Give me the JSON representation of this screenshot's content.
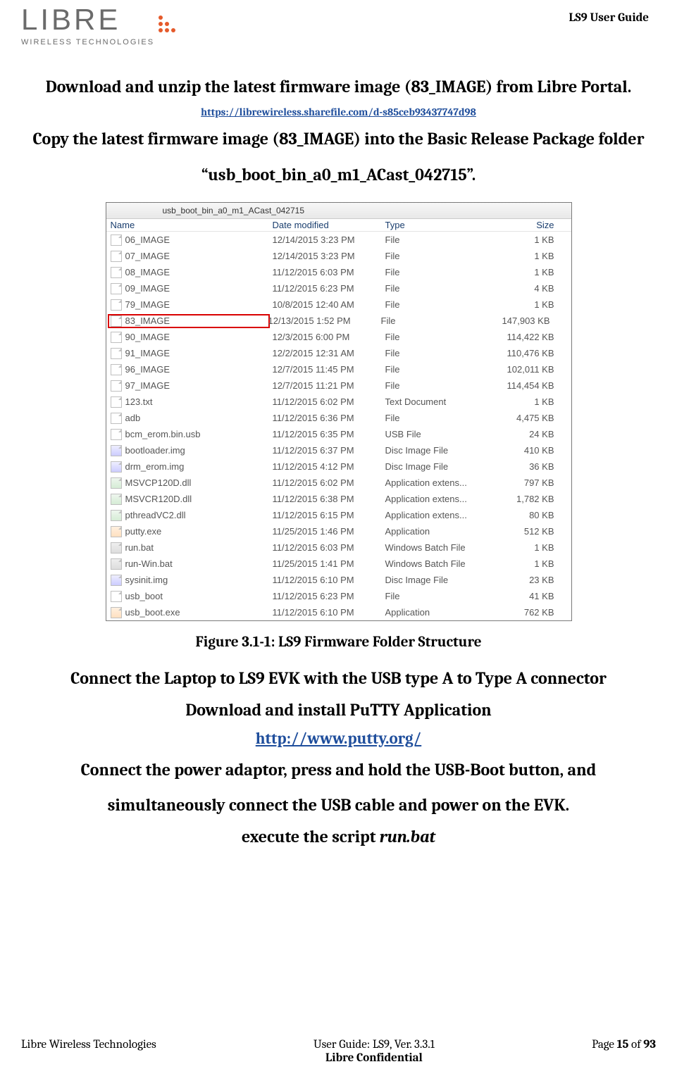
{
  "header": {
    "brand_main": "LIBRE",
    "brand_sub": "WIRELESS TECHNOLOGIES",
    "doc_title": "LS9 User Guide"
  },
  "body": {
    "instr1": "Download and unzip the latest firmware image (83_IMAGE) from Libre Portal.",
    "link1_text": "https://librewireless.sharefile.com/d-s85ceb93437747d98",
    "instr2": "Copy the latest firmware image (83_IMAGE) into the Basic Release Package folder “usb_boot_bin_a0_m1_ACast_042715”.",
    "figcap": "Figure 3.1-1: LS9 Firmware Folder Structure",
    "instr3": "Connect the Laptop to LS9 EVK with the USB type A to Type A connector",
    "instr4": "Download and install PuTTY Application",
    "link2_text": "http://www.putty.org/",
    "instr5": "Connect the power adaptor, press and hold the USB-Boot button, and simultaneously connect the USB cable and power on the EVK.",
    "instr6_prefix": "execute the script ",
    "instr6_italic": "run.bat"
  },
  "explorer": {
    "folder_name": "usb_boot_bin_a0_m1_ACast_042715",
    "cols": {
      "name": "Name",
      "date": "Date modified",
      "type": "Type",
      "size": "Size"
    },
    "rows": [
      {
        "icon": "file",
        "name": "06_IMAGE",
        "date": "12/14/2015 3:23 PM",
        "type": "File",
        "size": "1 KB",
        "hl": false
      },
      {
        "icon": "file",
        "name": "07_IMAGE",
        "date": "12/14/2015 3:23 PM",
        "type": "File",
        "size": "1 KB",
        "hl": false
      },
      {
        "icon": "file",
        "name": "08_IMAGE",
        "date": "11/12/2015 6:03 PM",
        "type": "File",
        "size": "1 KB",
        "hl": false
      },
      {
        "icon": "file",
        "name": "09_IMAGE",
        "date": "11/12/2015 6:23 PM",
        "type": "File",
        "size": "4 KB",
        "hl": false
      },
      {
        "icon": "file",
        "name": "79_IMAGE",
        "date": "10/8/2015 12:40 AM",
        "type": "File",
        "size": "1 KB",
        "hl": false
      },
      {
        "icon": "file",
        "name": "83_IMAGE",
        "date": "12/13/2015 1:52 PM",
        "type": "File",
        "size": "147,903 KB",
        "hl": true
      },
      {
        "icon": "file",
        "name": "90_IMAGE",
        "date": "12/3/2015 6:00 PM",
        "type": "File",
        "size": "114,422 KB",
        "hl": false
      },
      {
        "icon": "file",
        "name": "91_IMAGE",
        "date": "12/2/2015 12:31 AM",
        "type": "File",
        "size": "110,476 KB",
        "hl": false
      },
      {
        "icon": "file",
        "name": "96_IMAGE",
        "date": "12/7/2015 11:45 PM",
        "type": "File",
        "size": "102,011 KB",
        "hl": false
      },
      {
        "icon": "file",
        "name": "97_IMAGE",
        "date": "12/7/2015 11:21 PM",
        "type": "File",
        "size": "114,454 KB",
        "hl": false
      },
      {
        "icon": "txt",
        "name": "123.txt",
        "date": "11/12/2015 6:02 PM",
        "type": "Text Document",
        "size": "1 KB",
        "hl": false
      },
      {
        "icon": "file",
        "name": "adb",
        "date": "11/12/2015 6:36 PM",
        "type": "File",
        "size": "4,475 KB",
        "hl": false
      },
      {
        "icon": "file",
        "name": "bcm_erom.bin.usb",
        "date": "11/12/2015 6:35 PM",
        "type": "USB File",
        "size": "24 KB",
        "hl": false
      },
      {
        "icon": "img",
        "name": "bootloader.img",
        "date": "11/12/2015 6:37 PM",
        "type": "Disc Image File",
        "size": "410 KB",
        "hl": false
      },
      {
        "icon": "img",
        "name": "drm_erom.img",
        "date": "11/12/2015 4:12 PM",
        "type": "Disc Image File",
        "size": "36 KB",
        "hl": false
      },
      {
        "icon": "dll",
        "name": "MSVCP120D.dll",
        "date": "11/12/2015 6:02 PM",
        "type": "Application extens...",
        "size": "797 KB",
        "hl": false
      },
      {
        "icon": "dll",
        "name": "MSVCR120D.dll",
        "date": "11/12/2015 6:38 PM",
        "type": "Application extens...",
        "size": "1,782 KB",
        "hl": false
      },
      {
        "icon": "dll",
        "name": "pthreadVC2.dll",
        "date": "11/12/2015 6:15 PM",
        "type": "Application extens...",
        "size": "80 KB",
        "hl": false
      },
      {
        "icon": "exe",
        "name": "putty.exe",
        "date": "11/25/2015 1:46 PM",
        "type": "Application",
        "size": "512 KB",
        "hl": false
      },
      {
        "icon": "bat",
        "name": "run.bat",
        "date": "11/12/2015 6:03 PM",
        "type": "Windows Batch File",
        "size": "1 KB",
        "hl": false
      },
      {
        "icon": "bat",
        "name": "run-Win.bat",
        "date": "11/25/2015 1:41 PM",
        "type": "Windows Batch File",
        "size": "1 KB",
        "hl": false
      },
      {
        "icon": "img",
        "name": "sysinit.img",
        "date": "11/12/2015 6:10 PM",
        "type": "Disc Image File",
        "size": "23 KB",
        "hl": false
      },
      {
        "icon": "file",
        "name": "usb_boot",
        "date": "11/12/2015 6:23 PM",
        "type": "File",
        "size": "41 KB",
        "hl": false
      },
      {
        "icon": "exe",
        "name": "usb_boot.exe",
        "date": "11/12/2015 6:10 PM",
        "type": "Application",
        "size": "762 KB",
        "hl": false
      }
    ]
  },
  "footer": {
    "left": "Libre Wireless Technologies",
    "center_line1": "User Guide: LS9, Ver. 3.3.1",
    "center_line2": "Libre Confidential",
    "right_prefix": "Page ",
    "right_page": "15",
    "right_infix": " of ",
    "right_total": "93"
  }
}
